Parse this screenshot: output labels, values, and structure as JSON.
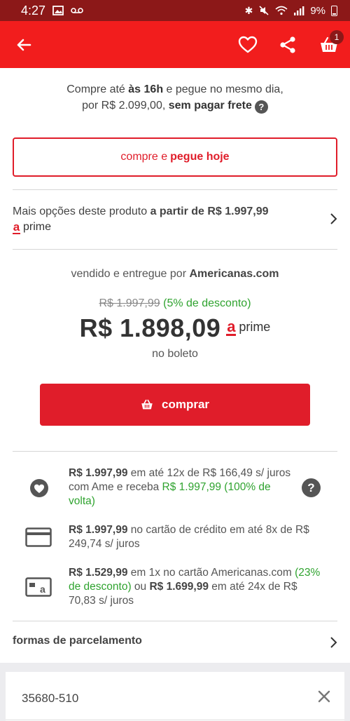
{
  "status_bar": {
    "time": "4:27",
    "battery": "9%",
    "icons": [
      "image-icon",
      "voicemail-icon",
      "bluetooth-icon",
      "mute-icon",
      "wifi-icon",
      "signal-icon",
      "battery-icon"
    ]
  },
  "app_bar": {
    "icons": [
      "back-arrow-icon",
      "heart-icon",
      "share-icon",
      "basket-icon"
    ],
    "cart_count": "1",
    "colors": {
      "background": "#f21d1d",
      "status": "#8c1818"
    }
  },
  "pickup": {
    "line1_a": "Compre até ",
    "line1_bold": "às 16h",
    "line1_b": " e pegue no mesmo dia,",
    "line2_a": "por R$ 2.099,00, ",
    "line2_bold": "sem pagar frete",
    "help": "?",
    "button_a": "compre e ",
    "button_bold": "pegue hoje"
  },
  "more_options": {
    "text": "Mais opções deste produto ",
    "bold": "a partir de R$ 1.997,99",
    "prime_logo": "a",
    "prime_label": "prime"
  },
  "offer": {
    "seller_prefix": "vendido e entregue por ",
    "seller_name": "Americanas.com",
    "old_price": "R$ 1.997,99",
    "discount": "(5% de desconto)",
    "price": "R$ 1.898,09",
    "prime_logo": "a",
    "prime_label": "prime",
    "payment_method": "no boleto",
    "buy_label": "comprar",
    "accent_color": "#e01d2a",
    "discount_color": "#2fa32f"
  },
  "payments": [
    {
      "icon": "ame-heart-icon",
      "bold1": "R$ 1.997,99",
      "text1": " em até 12x de R$ 166,49 s/ juros com Ame e receba ",
      "green1": "R$ 1.997,99 (100% de volta)",
      "help": "?"
    },
    {
      "icon": "credit-card-icon",
      "bold1": "R$ 1.997,99",
      "text1": " no cartão de crédito em até 8x de R$ 249,74 s/ juros"
    },
    {
      "icon": "americanas-card-icon",
      "bold1": "R$ 1.529,99",
      "text1": " em 1x no cartão Americanas.com ",
      "green1": "(23% de desconto)",
      "text2": " ou ",
      "bold2": "R$ 1.699,99",
      "text3": " em até 24x de R$ 70,83 s/ juros"
    }
  ],
  "installments_label": "formas de parcelamento",
  "cep": {
    "value": "35680-510"
  }
}
